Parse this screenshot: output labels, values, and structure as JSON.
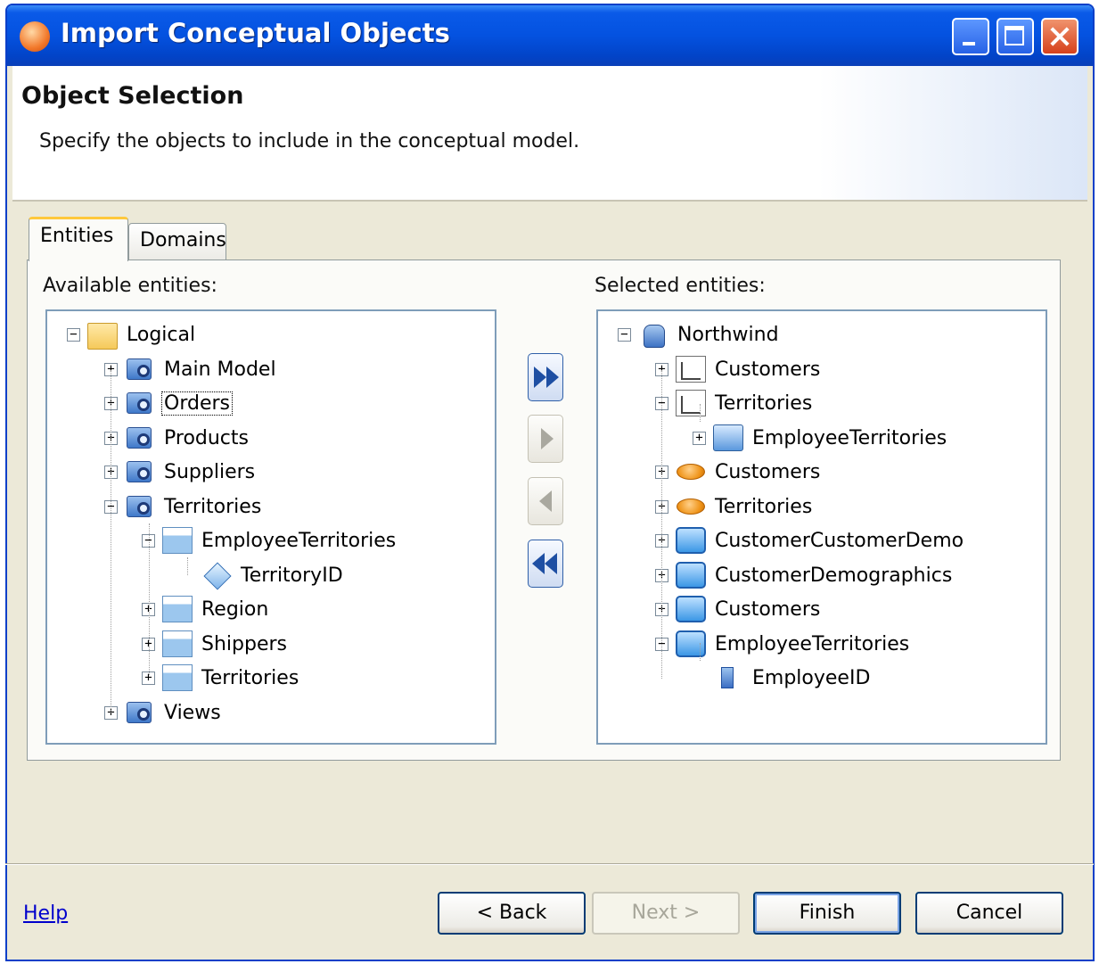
{
  "window": {
    "title": "Import Conceptual Objects"
  },
  "header": {
    "title": "Object Selection",
    "subtitle": "Specify the objects to include in the conceptual model."
  },
  "tabs": [
    {
      "label": "Entities",
      "selected": true
    },
    {
      "label": "Domains",
      "selected": false
    }
  ],
  "available": {
    "label": "Available entities:",
    "nodes": [
      {
        "label": "Logical",
        "icon": "folder-open-icon",
        "toggle": "−"
      },
      {
        "label": "Main Model",
        "icon": "model-icon",
        "toggle": "+"
      },
      {
        "label": "Orders",
        "icon": "model-icon",
        "toggle": "+",
        "focused": true
      },
      {
        "label": "Products",
        "icon": "model-icon",
        "toggle": "+"
      },
      {
        "label": "Suppliers",
        "icon": "model-icon",
        "toggle": "+"
      },
      {
        "label": "Territories",
        "icon": "model-icon",
        "toggle": "−"
      },
      {
        "label": "EmployeeTerritories",
        "icon": "table-icon",
        "toggle": "−"
      },
      {
        "label": "TerritoryID",
        "icon": "key-icon",
        "toggle": ""
      },
      {
        "label": "Region",
        "icon": "table-icon",
        "toggle": "+"
      },
      {
        "label": "Shippers",
        "icon": "table-icon",
        "toggle": "+"
      },
      {
        "label": "Territories",
        "icon": "table-icon",
        "toggle": "+"
      },
      {
        "label": "Views",
        "icon": "model-icon",
        "toggle": "+"
      }
    ]
  },
  "selected": {
    "label": "Selected entities:",
    "nodes": [
      {
        "label": "Northwind",
        "icon": "database-icon",
        "toggle": "−"
      },
      {
        "label": "Customers",
        "icon": "entity-icon",
        "toggle": "+"
      },
      {
        "label": "Territories",
        "icon": "entity-icon",
        "toggle": "−"
      },
      {
        "label": "EmployeeTerritories",
        "icon": "entity-link-icon",
        "toggle": "+"
      },
      {
        "label": "Customers",
        "icon": "orange-entity-icon",
        "toggle": "+"
      },
      {
        "label": "Territories",
        "icon": "orange-entity-icon",
        "toggle": "+"
      },
      {
        "label": "CustomerCustomerDemo",
        "icon": "blue-entity-icon",
        "toggle": "+"
      },
      {
        "label": "CustomerDemographics",
        "icon": "blue-entity-icon",
        "toggle": "+"
      },
      {
        "label": "Customers",
        "icon": "blue-entity-icon",
        "toggle": "+"
      },
      {
        "label": "EmployeeTerritories",
        "icon": "blue-entity-icon",
        "toggle": "−"
      },
      {
        "label": "EmployeeID",
        "icon": "property-icon",
        "toggle": ""
      }
    ]
  },
  "transfer_buttons": [
    {
      "name": "add-all",
      "icon": "double-right-arrow-icon",
      "enabled": true
    },
    {
      "name": "add",
      "icon": "right-arrow-icon",
      "enabled": false
    },
    {
      "name": "remove",
      "icon": "left-arrow-icon",
      "enabled": false
    },
    {
      "name": "remove-all",
      "icon": "double-left-arrow-icon",
      "enabled": true
    }
  ],
  "footer": {
    "help": "Help",
    "back": "< Back",
    "next": "Next >",
    "finish": "Finish",
    "cancel": "Cancel"
  },
  "colors": {
    "titlebar": "#0452e0",
    "dialog_bg": "#ece9d8",
    "tab_accent": "#ffc83c",
    "link": "#0000cc"
  }
}
